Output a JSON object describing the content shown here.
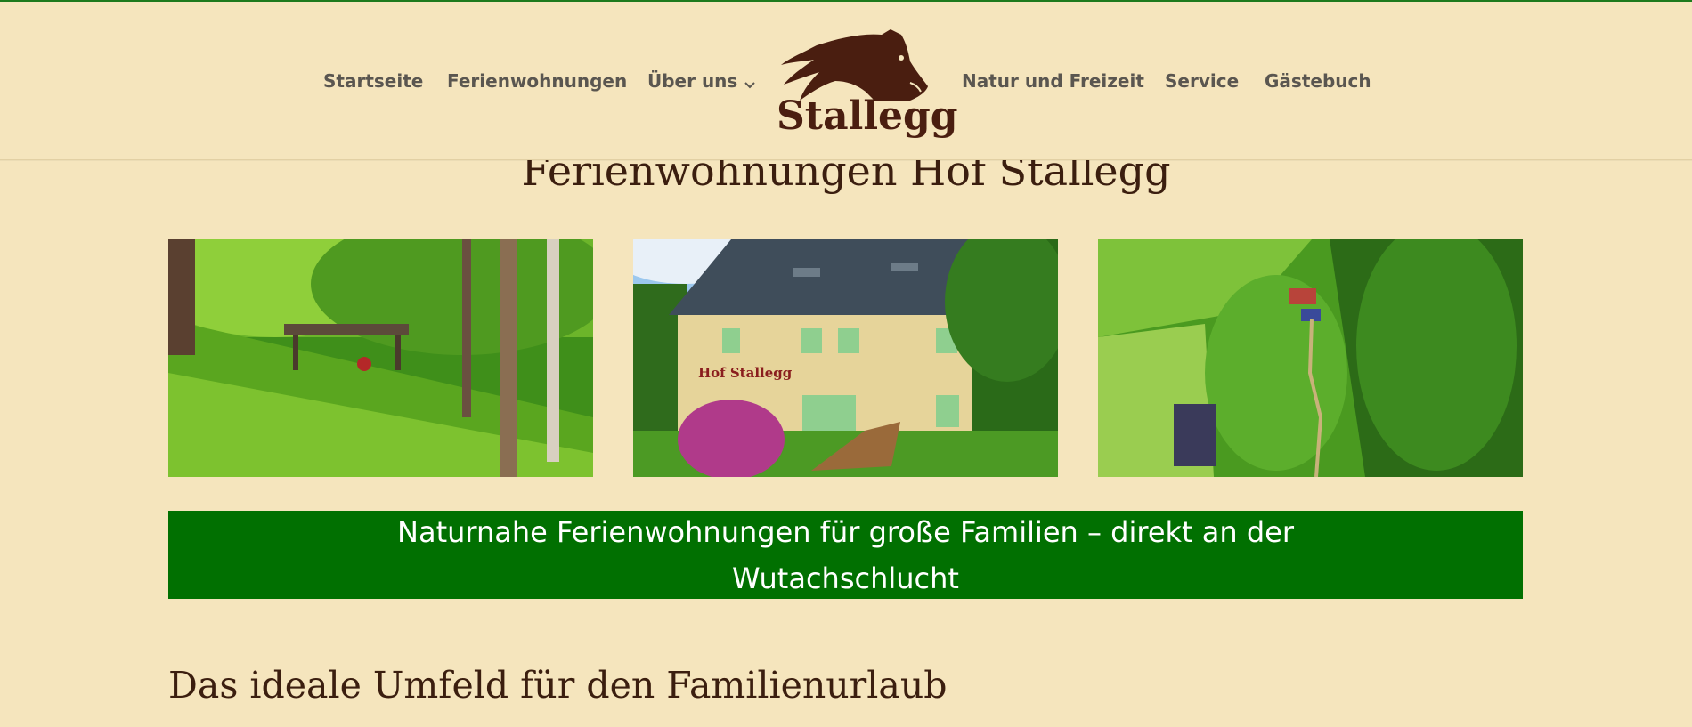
{
  "header": {
    "nav_left": [
      "Startseite",
      "Ferienwohnungen",
      "Über uns"
    ],
    "nav_right": [
      "Natur und Freizeit",
      "Service",
      "Gästebuch"
    ],
    "logo_text": "Stallegg",
    "submenu_icon": "chevron-down-icon"
  },
  "main": {
    "page_title": "Ferienwohnungen Hof Stallegg",
    "photos": [
      {
        "name": "garden-photo"
      },
      {
        "name": "house-photo",
        "sign_text": "Hof Stallegg"
      },
      {
        "name": "aerial-photo"
      }
    ],
    "banner_text": "Naturnahe Ferienwohnungen für große Familien – direkt an der Wutachschlucht",
    "section_heading": "Das ideale Umfeld für den Familienurlaub"
  },
  "colors": {
    "background": "#f5e5bd",
    "banner": "#017001",
    "heading": "#3b1e0f",
    "nav_text": "#5a5650",
    "logo": "#4a1e10"
  }
}
